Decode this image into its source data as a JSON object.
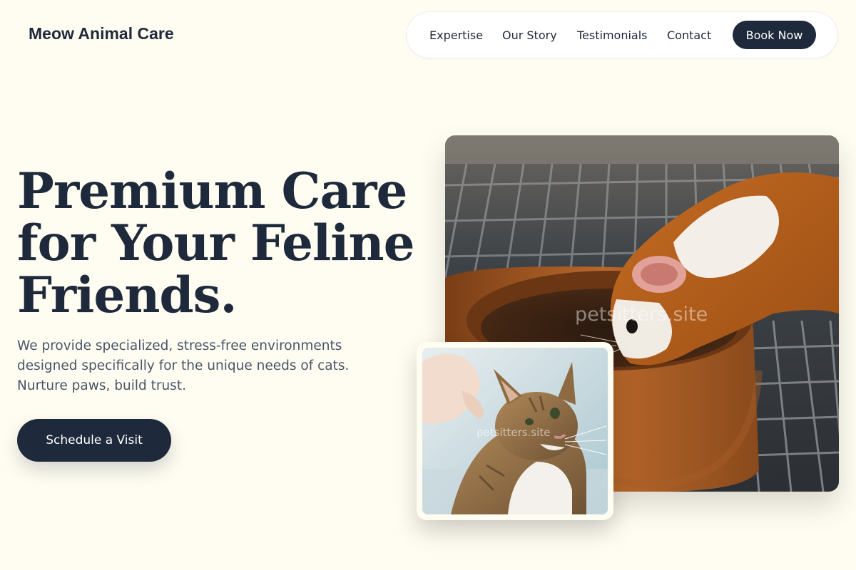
{
  "header": {
    "brand": "Meow Animal Care",
    "nav": {
      "links": [
        "Expertise",
        "Our Story",
        "Testimonials",
        "Contact"
      ],
      "cta_label": "Book Now"
    }
  },
  "hero": {
    "title": "Premium Care for Your Feline Friends.",
    "subtitle": "We provide specialized, stress-free environments designed specifically for the unique needs of cats. Nurture paws, build trust.",
    "cta_label": "Schedule a Visit"
  },
  "images": {
    "main_watermark": "petsitters.site",
    "small_watermark": "petsitters.site"
  },
  "colors": {
    "background": "#fffdf1",
    "primary": "#1e293b",
    "text_muted": "#475569"
  }
}
